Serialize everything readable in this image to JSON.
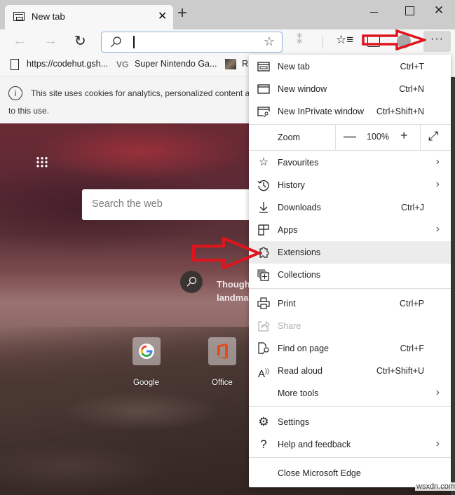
{
  "browser": {
    "tab": {
      "title": "New tab",
      "close": "✕"
    },
    "new_tab_button": "+",
    "window_controls": {
      "close": "✕"
    },
    "toolbar": {
      "back_icon": "←",
      "forward_icon": "→",
      "refresh_icon": "↻",
      "address_value": "",
      "add_favorite_icon": "☆",
      "read_aloud_icon": "⁑",
      "favorites_icon": "☆≡",
      "more_label": "···"
    },
    "bookmarks": [
      {
        "label": "https://codehut.gsh...",
        "icon": "document-icon"
      },
      {
        "label": "Super Nintendo Ga...",
        "icon": "vg-icon",
        "icon_text": "VG"
      },
      {
        "label": "R",
        "icon": "image-icon"
      }
    ],
    "cookie_banner": {
      "icon": "i",
      "line1": "This site uses cookies for analytics, personalized content ar",
      "line2": "to this use."
    }
  },
  "newtab_page": {
    "search_placeholder": "Search the web",
    "caption_line1": "Though",
    "caption_line2": "landma",
    "tiles": [
      {
        "label": "Google"
      },
      {
        "label": "Office"
      }
    ]
  },
  "menu": {
    "items": [
      {
        "id": "new-tab",
        "label": "New tab",
        "shortcut": "Ctrl+T",
        "icon": "new-tab-icon"
      },
      {
        "id": "new-window",
        "label": "New window",
        "shortcut": "Ctrl+N",
        "icon": "window-icon"
      },
      {
        "id": "new-inprivate",
        "label": "New InPrivate window",
        "shortcut": "Ctrl+Shift+N",
        "icon": "inprivate-icon"
      },
      {
        "id": "favourites",
        "label": "Favourites",
        "shortcut": "",
        "icon": "favourites-icon",
        "submenu": true
      },
      {
        "id": "history",
        "label": "History",
        "shortcut": "",
        "icon": "history-icon",
        "submenu": true
      },
      {
        "id": "downloads",
        "label": "Downloads",
        "shortcut": "Ctrl+J",
        "icon": "download-icon"
      },
      {
        "id": "apps",
        "label": "Apps",
        "shortcut": "",
        "icon": "apps-icon",
        "submenu": true
      },
      {
        "id": "extensions",
        "label": "Extensions",
        "shortcut": "",
        "icon": "puzzle-icon",
        "highlighted": true
      },
      {
        "id": "collections",
        "label": "Collections",
        "shortcut": "",
        "icon": "collections-icon"
      },
      {
        "id": "print",
        "label": "Print",
        "shortcut": "Ctrl+P",
        "icon": "printer-icon"
      },
      {
        "id": "share",
        "label": "Share",
        "shortcut": "",
        "icon": "share-icon",
        "disabled": true
      },
      {
        "id": "find",
        "label": "Find on page",
        "shortcut": "Ctrl+F",
        "icon": "find-icon"
      },
      {
        "id": "read-aloud",
        "label": "Read aloud",
        "shortcut": "Ctrl+Shift+U",
        "icon": "read-aloud-icon"
      },
      {
        "id": "more-tools",
        "label": "More tools",
        "shortcut": "",
        "icon": "",
        "submenu": true
      },
      {
        "id": "settings",
        "label": "Settings",
        "shortcut": "",
        "icon": "gear-icon"
      },
      {
        "id": "help",
        "label": "Help and feedback",
        "shortcut": "",
        "icon": "help-icon",
        "submenu": true
      },
      {
        "id": "close-edge",
        "label": "Close Microsoft Edge",
        "shortcut": "",
        "icon": ""
      }
    ],
    "zoom": {
      "label": "Zoom",
      "minus": "—",
      "value": "100%",
      "plus": "+",
      "fullscreen": "⤢"
    },
    "chevron": "›"
  },
  "watermark": "wsxdn.com",
  "colors": {
    "annotation_arrow": "#e0141e",
    "address_border": "#8fb2df",
    "menu_highlight": "#ececec"
  }
}
